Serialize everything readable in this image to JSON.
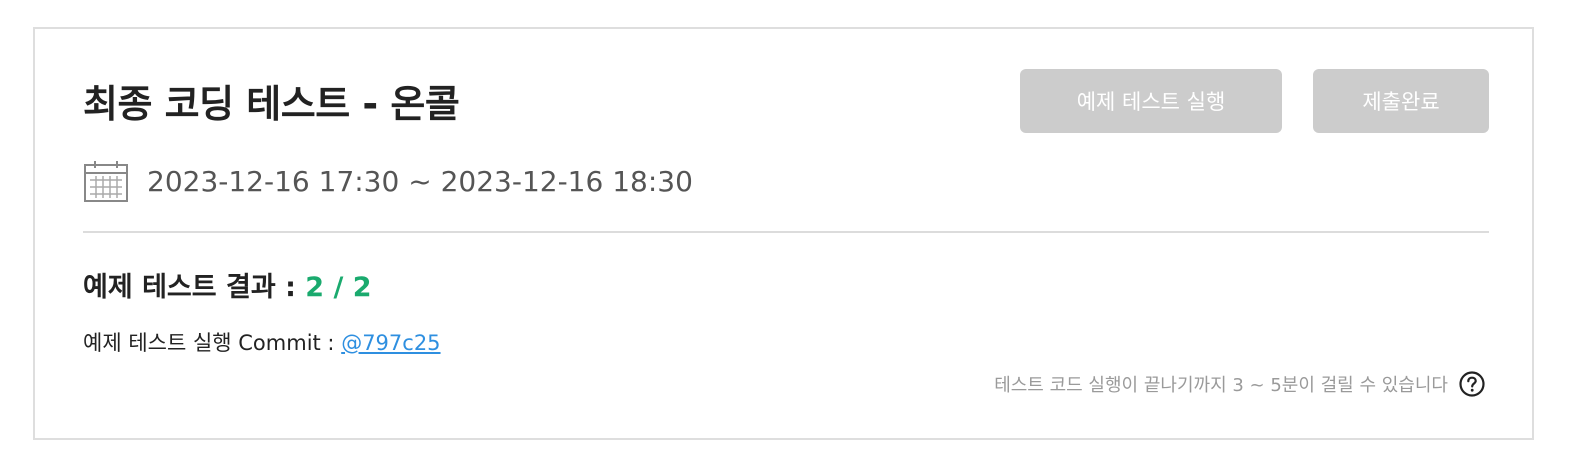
{
  "header": {
    "title": "최종 코딩 테스트 - 온콜",
    "run_button_label": "예제 테스트 실행",
    "submit_button_label": "제출완료"
  },
  "schedule": {
    "icon": "calendar-icon",
    "period": "2023-12-16 17:30 ~ 2023-12-16 18:30"
  },
  "result": {
    "label": "예제 테스트 결과 : ",
    "score": "2 / 2",
    "score_color": "#1aaa6e"
  },
  "commit": {
    "label": "예제 테스트 실행 Commit : ",
    "hash": "@797c25",
    "link_color": "#2e8fe0"
  },
  "notice": {
    "text": "테스트 코드 실행이 끝나기까지 3 ~ 5분이 걸릴 수 있습니다",
    "icon": "help-icon"
  },
  "colors": {
    "button_bg": "#cccccc",
    "border": "#dedede",
    "title": "#222222"
  }
}
